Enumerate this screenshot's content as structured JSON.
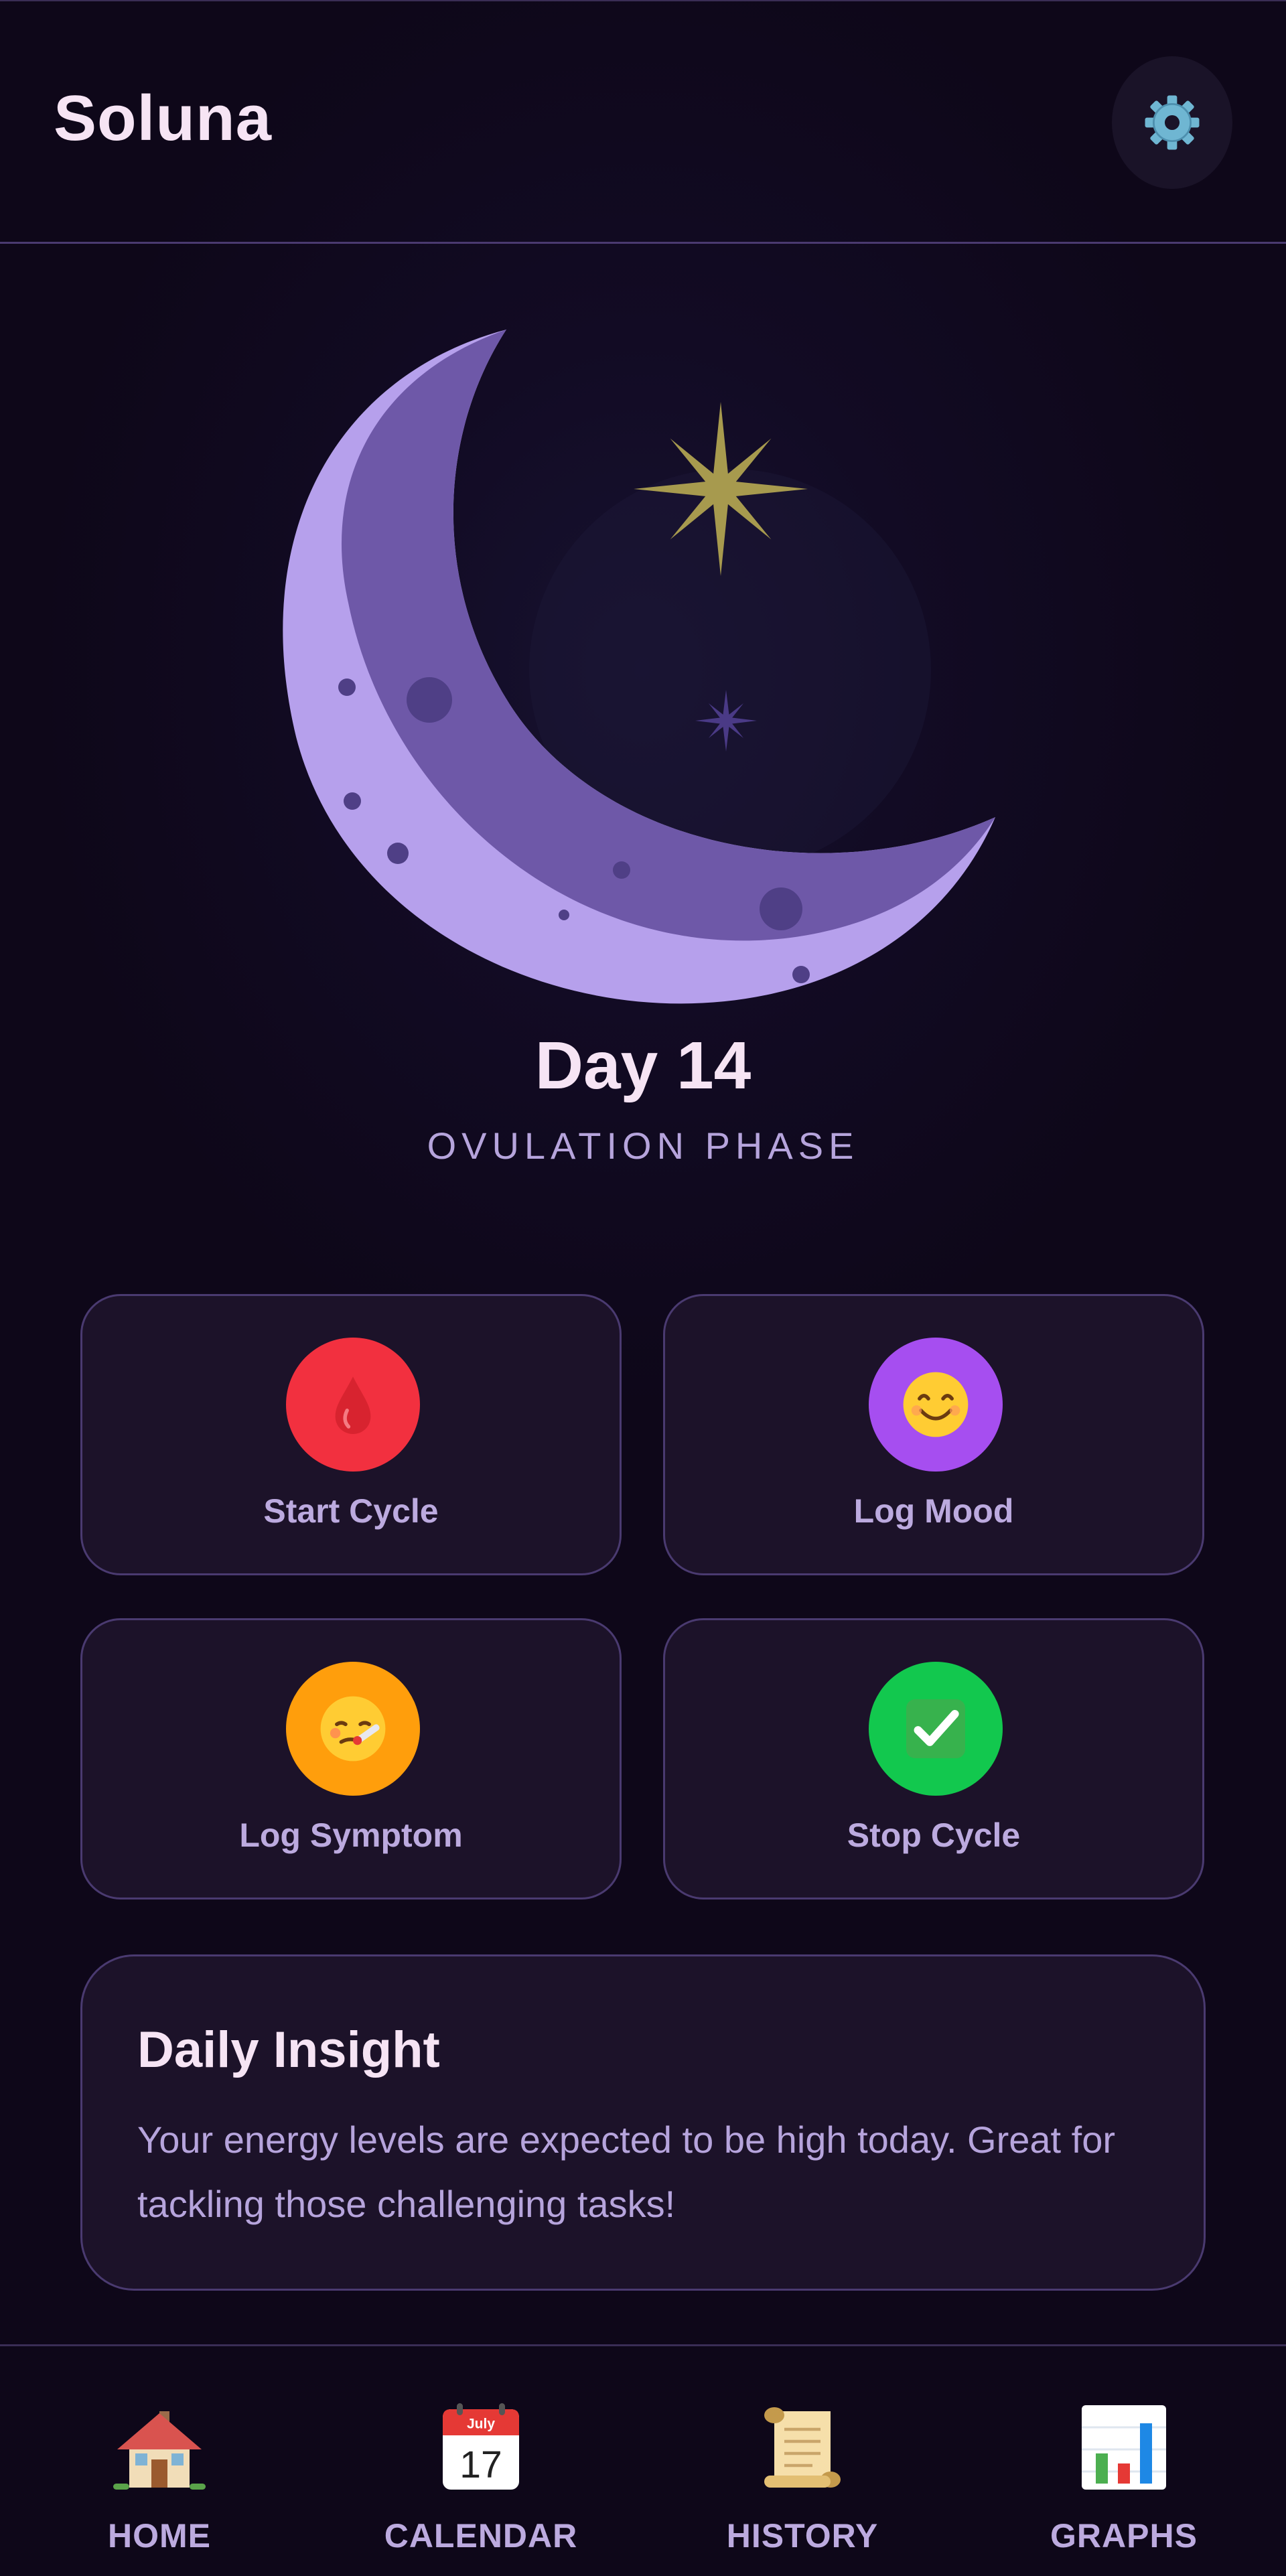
{
  "app": {
    "title": "Soluna"
  },
  "header": {
    "settings_icon": "gear-icon"
  },
  "hero": {
    "day": "Day 14",
    "phase": "OVULATION PHASE",
    "illustration": "crescent-moon-with-stars"
  },
  "actions": [
    {
      "label": "Start Cycle",
      "icon": "blood-drop-icon",
      "color": "#f2303f"
    },
    {
      "label": "Log Mood",
      "icon": "smiley-face-icon",
      "color": "#a64ef0"
    },
    {
      "label": "Log Symptom",
      "icon": "sick-face-thermometer-icon",
      "color": "#ff9e0c"
    },
    {
      "label": "Stop Cycle",
      "icon": "check-mark-icon",
      "color": "#12c84e"
    }
  ],
  "insight": {
    "title": "Daily Insight",
    "body": "Your energy levels are expected to be high today. Great for tackling those challenging tasks!"
  },
  "nav": [
    {
      "label": "HOME",
      "icon": "house-icon"
    },
    {
      "label": "CALENDAR",
      "icon": "calendar-icon",
      "calendar_month": "July",
      "calendar_day": "17"
    },
    {
      "label": "HISTORY",
      "icon": "scroll-icon"
    },
    {
      "label": "GRAPHS",
      "icon": "bar-chart-icon"
    }
  ],
  "colors": {
    "background": "#0e0719",
    "card": "#1c1229",
    "border": "#4a3a70",
    "title": "#f6e4f4",
    "label": "#bcaadf",
    "moon_light": "#b6a0ec",
    "moon_dark": "#6e58a8",
    "star": "#a79a4e"
  }
}
